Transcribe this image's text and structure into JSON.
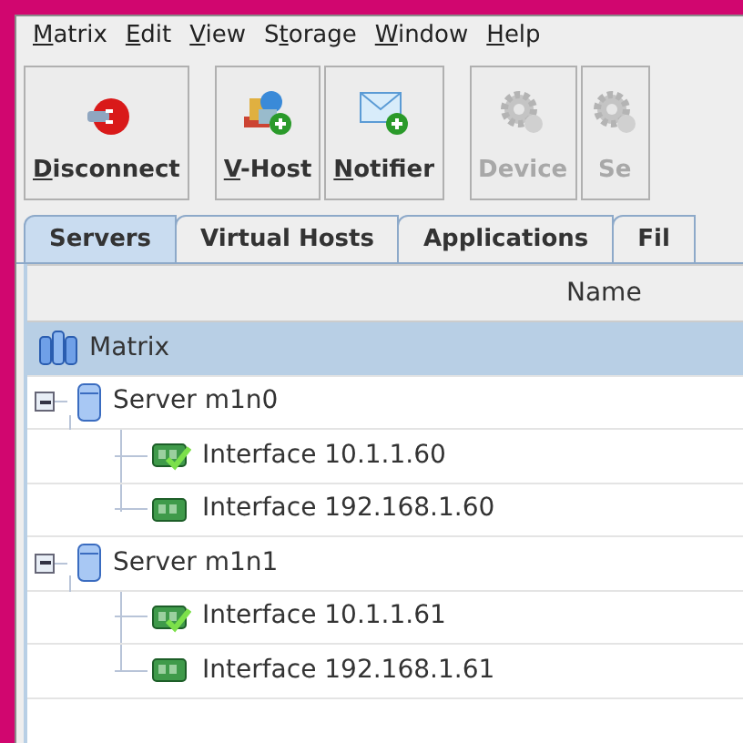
{
  "menu": [
    {
      "key": "M",
      "rest": "atrix"
    },
    {
      "key": "E",
      "rest": "dit"
    },
    {
      "key": "V",
      "rest": "iew"
    },
    {
      "pre": "S",
      "key": "t",
      "rest": "orage"
    },
    {
      "key": "W",
      "rest": "indow"
    },
    {
      "key": "H",
      "rest": "elp"
    }
  ],
  "toolbar": [
    {
      "key": "D",
      "rest": "isconnect",
      "kind": "plug",
      "disabled": false
    },
    {
      "key": "V",
      "rest": "-Host",
      "kind": "vhost",
      "disabled": false
    },
    {
      "key": "N",
      "rest": "otifier",
      "kind": "mail",
      "disabled": false
    },
    {
      "rest": "Device",
      "kind": "gear",
      "disabled": true
    },
    {
      "rest": "Se",
      "kind": "gear",
      "disabled": true
    }
  ],
  "tabs": [
    {
      "label": "Servers",
      "selected": true
    },
    {
      "label": "Virtual Hosts",
      "selected": false
    },
    {
      "label": "Applications",
      "selected": false
    },
    {
      "label": "Fil",
      "selected": false
    }
  ],
  "table": {
    "columns": [
      "Name"
    ],
    "tree": [
      {
        "label": "Matrix",
        "kind": "cluster",
        "selected": true,
        "children": [
          {
            "label": "Server m1n0",
            "kind": "server",
            "selected": false,
            "expanded": true,
            "children": [
              {
                "label": "Interface 10.1.1.60",
                "kind": "interface",
                "selected": false,
                "verified": true
              },
              {
                "label": "Interface 192.168.1.60",
                "kind": "interface",
                "selected": false,
                "verified": false
              }
            ]
          },
          {
            "label": "Server m1n1",
            "kind": "server",
            "selected": false,
            "expanded": true,
            "children": [
              {
                "label": "Interface 10.1.1.61",
                "kind": "interface",
                "selected": false,
                "verified": true
              },
              {
                "label": "Interface 192.168.1.61",
                "kind": "interface",
                "selected": false,
                "verified": false
              }
            ]
          }
        ]
      }
    ]
  }
}
